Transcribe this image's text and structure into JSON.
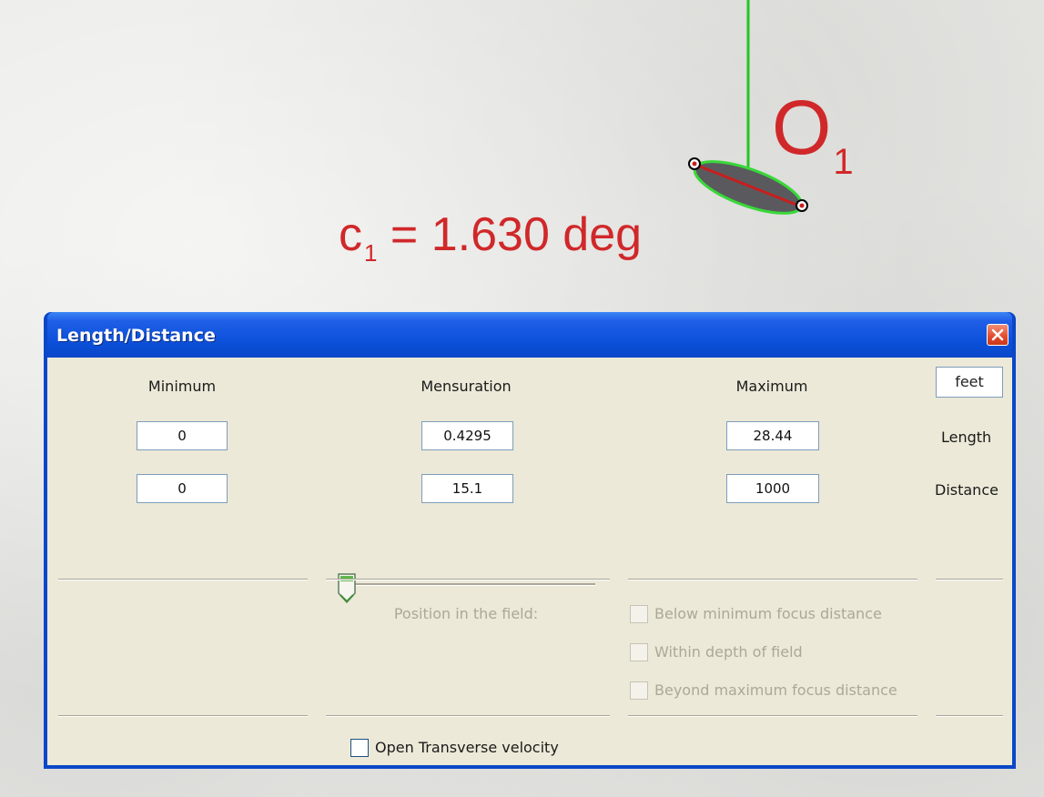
{
  "annotations": {
    "c1_symbol": "c",
    "c1_subscript": "1",
    "c1_value": " = 1.630 deg",
    "o1_symbol": "O",
    "o1_subscript": "1"
  },
  "dialog": {
    "title": "Length/Distance",
    "unit": "feet",
    "columns": {
      "minimum": "Minimum",
      "mensuration": "Mensuration",
      "maximum": "Maximum"
    },
    "rows": {
      "length_label": "Length",
      "distance_label": "Distance"
    },
    "values": {
      "length_min": "0",
      "length_mensuration": "0.4295",
      "length_max": "28.44",
      "distance_min": "0",
      "distance_mensuration": "15.1",
      "distance_max": "1000"
    },
    "slider_fraction": 0.0,
    "position_label": "Position in the field:",
    "focus_options": [
      {
        "label": "Below minimum focus distance",
        "checked": false,
        "enabled": false
      },
      {
        "label": "Within depth of field",
        "checked": false,
        "enabled": false
      },
      {
        "label": "Beyond maximum focus distance",
        "checked": false,
        "enabled": false
      }
    ],
    "transverse_checkbox_label": "Open Transverse velocity",
    "transverse_checked": false
  },
  "colors": {
    "annotation_red": "#d0282a",
    "vector_green": "#22c622",
    "titlebar_blue": "#0a47c8",
    "dialog_face": "#ece9d8"
  }
}
